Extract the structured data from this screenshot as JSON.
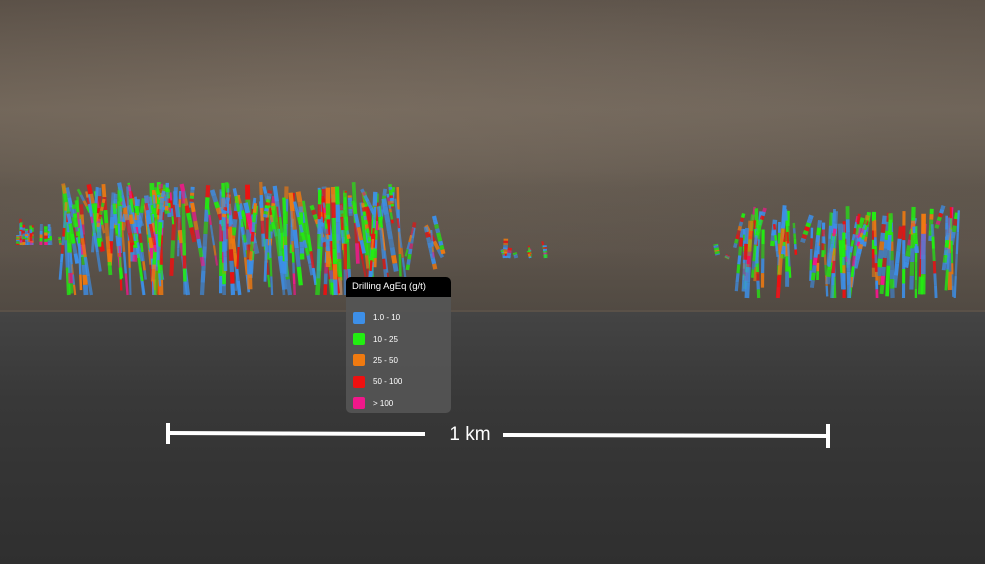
{
  "legend": {
    "title": "Drilling AgEq (g/t)",
    "items": [
      {
        "label": "1.0 - 10",
        "color": "#3d8fe8"
      },
      {
        "label": "10 - 25",
        "color": "#22ee11"
      },
      {
        "label": "25 - 50",
        "color": "#f07a10"
      },
      {
        "label": "50 - 100",
        "color": "#ee1010"
      },
      {
        "label": "> 100",
        "color": "#f0188a"
      }
    ]
  },
  "scale_bar": {
    "label": "1 km"
  }
}
